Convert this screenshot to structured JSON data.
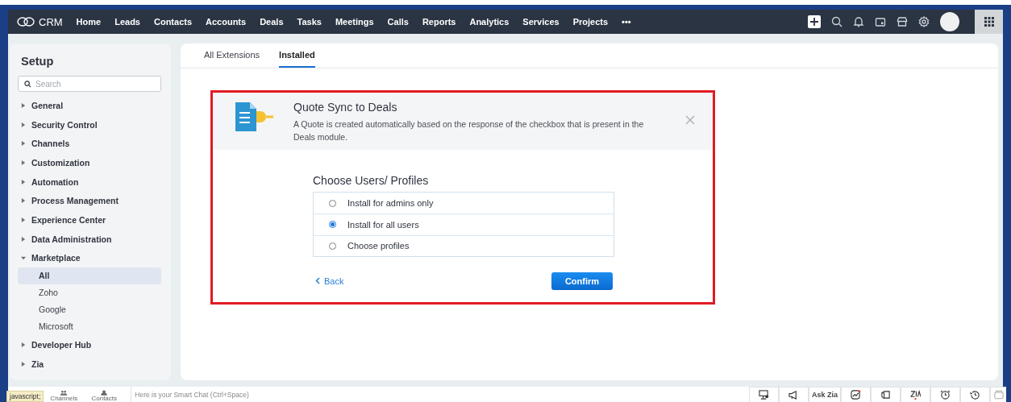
{
  "nav": {
    "logo": "CRM",
    "items": [
      {
        "label": "Home"
      },
      {
        "label": "Leads"
      },
      {
        "label": "Contacts"
      },
      {
        "label": "Accounts"
      },
      {
        "label": "Deals"
      },
      {
        "label": "Tasks"
      },
      {
        "label": "Meetings"
      },
      {
        "label": "Calls"
      },
      {
        "label": "Reports"
      },
      {
        "label": "Analytics"
      },
      {
        "label": "Services"
      },
      {
        "label": "Projects"
      }
    ],
    "more": "•••"
  },
  "setup": {
    "title": "Setup",
    "search": {
      "placeholder": "Search"
    },
    "items": [
      {
        "label": "General",
        "expanded": false
      },
      {
        "label": "Security Control",
        "expanded": false
      },
      {
        "label": "Channels",
        "expanded": false
      },
      {
        "label": "Customization",
        "expanded": false
      },
      {
        "label": "Automation",
        "expanded": false
      },
      {
        "label": "Process Management",
        "expanded": false
      },
      {
        "label": "Experience Center",
        "expanded": false
      },
      {
        "label": "Data Administration",
        "expanded": false
      },
      {
        "label": "Marketplace",
        "expanded": true,
        "children": [
          {
            "label": "All",
            "selected": true
          },
          {
            "label": "Zoho",
            "selected": false
          },
          {
            "label": "Google",
            "selected": false
          },
          {
            "label": "Microsoft",
            "selected": false
          }
        ]
      },
      {
        "label": "Developer Hub",
        "expanded": false
      },
      {
        "label": "Zia",
        "expanded": false
      }
    ]
  },
  "tabs": [
    {
      "label": "All Extensions",
      "selected": false
    },
    {
      "label": "Installed",
      "selected": true
    }
  ],
  "extension": {
    "title": "Quote Sync to Deals",
    "description": "A Quote is created automatically based on the response of the checkbox that is present in the Deals module."
  },
  "install": {
    "heading": "Choose Users/ Profiles",
    "options": [
      {
        "label": "Install for admins only",
        "selected": false
      },
      {
        "label": "Install for all users",
        "selected": true
      },
      {
        "label": "Choose profiles",
        "selected": false
      }
    ],
    "back": "Back",
    "confirm": "Confirm"
  },
  "bottom_bar": {
    "status_tip": "javascript;",
    "shortcuts": [
      {
        "label": "Channels"
      },
      {
        "label": "Contacts"
      }
    ],
    "chat": {
      "placeholder": "Here is your Smart Chat (Ctrl+Space)"
    },
    "ask_zia": "Ask Zia"
  }
}
